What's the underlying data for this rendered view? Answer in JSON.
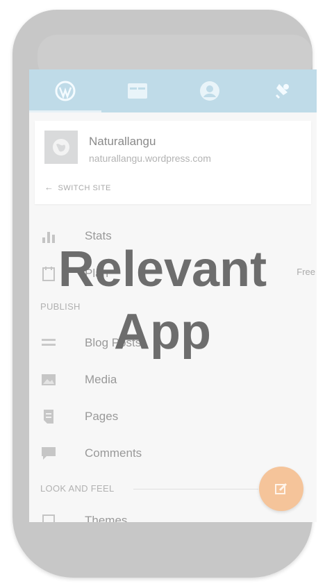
{
  "site": {
    "name": "Naturallangu",
    "url": "naturallangu.wordpress.com",
    "switch_label": "SWITCH SITE"
  },
  "tabs": [
    {
      "icon": "wordpress-icon"
    },
    {
      "icon": "reader-icon"
    },
    {
      "icon": "profile-icon"
    },
    {
      "icon": "notifications-icon"
    }
  ],
  "menu": {
    "stats": "Stats",
    "plan": "Plan",
    "plan_value": "Free",
    "publish_header": "PUBLISH",
    "blog_posts": "Blog Posts",
    "media": "Media",
    "pages": "Pages",
    "comments": "Comments",
    "look_header": "LOOK AND FEEL",
    "themes": "Themes"
  },
  "overlay": {
    "line1": "Relevant",
    "line2": "App"
  },
  "colors": {
    "topbar": "#bfdbe8",
    "fab": "#f5c49a",
    "phone": "#c7c7c7"
  }
}
